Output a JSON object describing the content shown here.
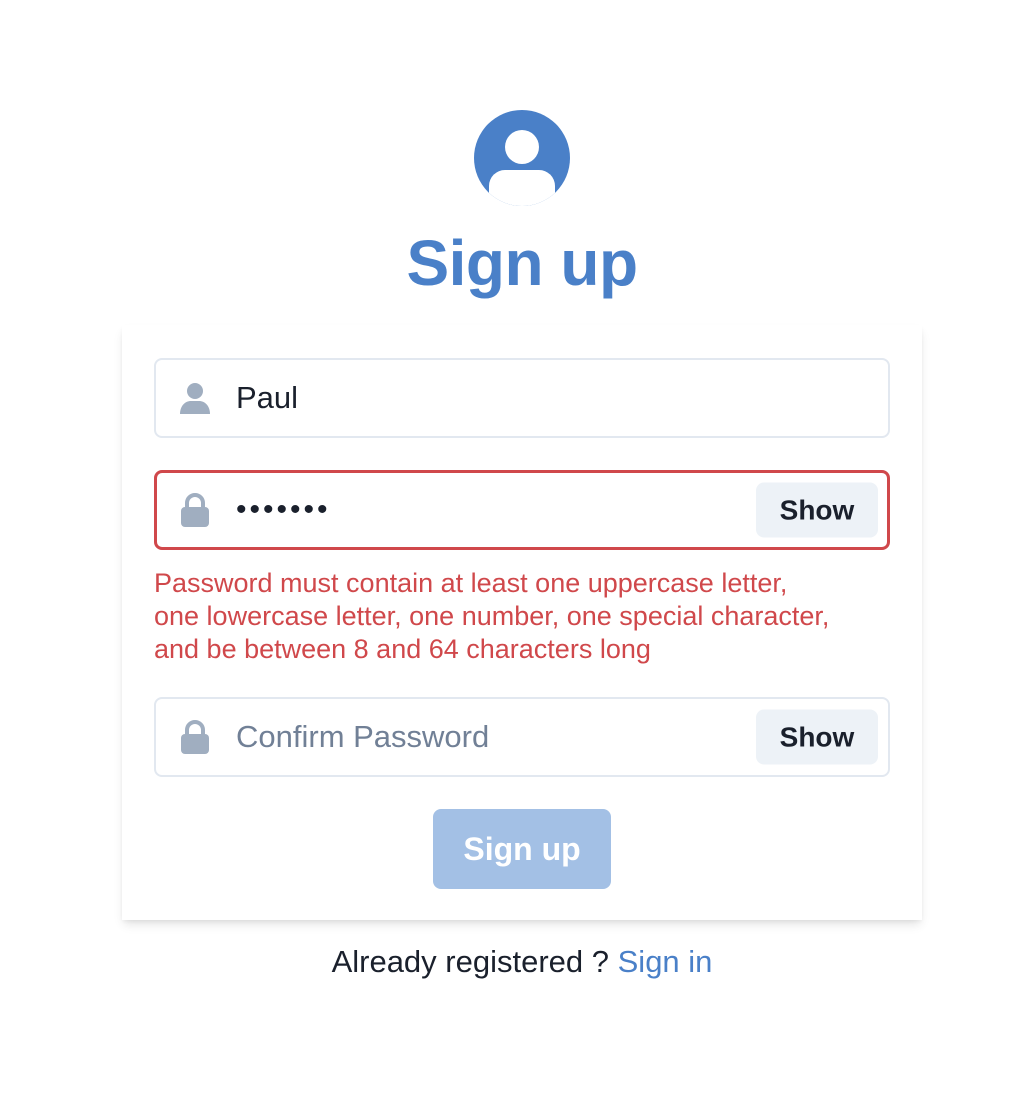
{
  "header": {
    "avatar_icon": "user-circle-icon",
    "title": "Sign up"
  },
  "colors": {
    "brand": "#4a80c8",
    "error": "#d0484b",
    "icon_gray": "#a0aec0",
    "button_disabled": "#a3c0e5"
  },
  "form": {
    "username": {
      "icon": "user-icon",
      "value": "Paul"
    },
    "password": {
      "icon": "lock-icon",
      "value": "Paul123",
      "show_label": "Show",
      "error_lines": [
        "Password must contain at least one uppercase letter,",
        "one lowercase letter, one number, one special character,",
        "and be between 8 and 64 characters long"
      ]
    },
    "confirm_password": {
      "icon": "lock-icon",
      "value": "",
      "placeholder": "Confirm Password",
      "show_label": "Show"
    },
    "submit_label": "Sign up"
  },
  "footer": {
    "prompt": "Already registered ?",
    "link_label": "Sign in"
  }
}
